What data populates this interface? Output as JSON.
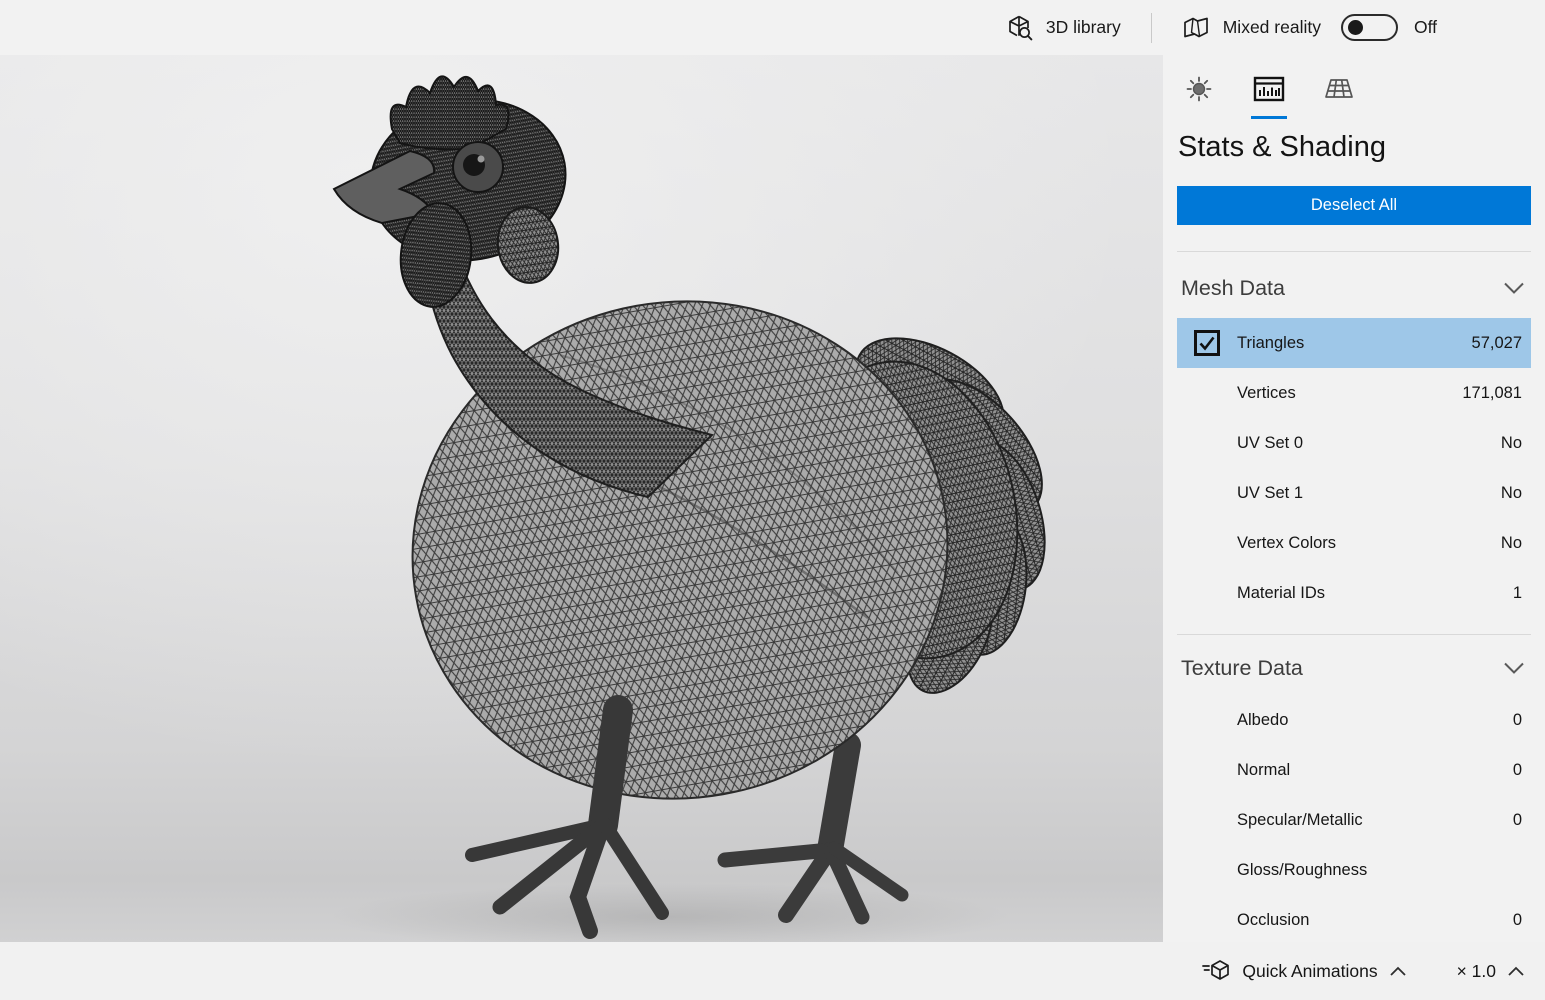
{
  "topbar": {
    "library_label": "3D library",
    "mixed_reality_label": "Mixed reality",
    "mixed_reality_state": "Off"
  },
  "panel": {
    "title": "Stats & Shading",
    "deselect_label": "Deselect All",
    "mesh_section_title": "Mesh Data",
    "texture_section_title": "Texture Data",
    "mesh_rows": [
      {
        "label": "Triangles",
        "value": "57,027",
        "checked": true,
        "highlighted": true
      },
      {
        "label": "Vertices",
        "value": "171,081"
      },
      {
        "label": "UV Set 0",
        "value": "No"
      },
      {
        "label": "UV Set 1",
        "value": "No"
      },
      {
        "label": "Vertex Colors",
        "value": "No"
      },
      {
        "label": "Material IDs",
        "value": "1"
      }
    ],
    "texture_rows": [
      {
        "label": "Albedo",
        "value": "0"
      },
      {
        "label": "Normal",
        "value": "0"
      },
      {
        "label": "Specular/Metallic",
        "value": "0"
      },
      {
        "label": "Gloss/Roughness",
        "value": ""
      },
      {
        "label": "Occlusion",
        "value": "0"
      }
    ]
  },
  "bottombar": {
    "quick_animations_label": "Quick Animations",
    "playback_speed": "× 1.0"
  },
  "viewport": {
    "model_description": "wireframe chicken 3D model"
  },
  "icons": {
    "library": "3d-cube-search-icon",
    "mixed_reality": "mixed-reality-icon",
    "lighting_tab": "sun-icon",
    "stats_tab": "bar-chart-window-icon",
    "environment_tab": "perspective-grid-icon",
    "section": "chevron-down-icon",
    "row_checkbox": "checked-checkbox-icon",
    "quick_animations": "cube-motion-icon",
    "expand": "chevron-up-icon"
  },
  "colors": {
    "accent": "#0078d7",
    "row_highlight": "#9ec7e8",
    "chrome_bg": "#f2f2f2",
    "bottombar_bg": "#f1f1f1"
  }
}
